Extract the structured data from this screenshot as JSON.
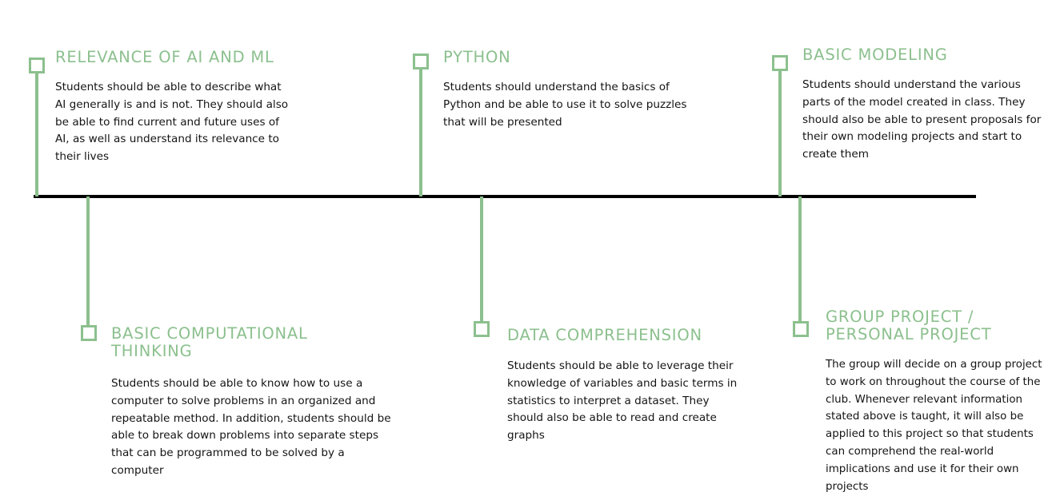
{
  "colors": {
    "accent": "#8cc08e",
    "axis": "#000000",
    "text": "#141414"
  },
  "milestones": {
    "relevance": {
      "title": "RELEVANCE OF AI AND ML",
      "description": "Students should be able to describe what AI generally is and is not. They should also be able to find current and future uses of AI, as well as understand its relevance to their lives"
    },
    "python": {
      "title": "PYTHON",
      "description": "Students should understand the basics of Python and be able to use it to solve puzzles that will be presented"
    },
    "basic_modeling": {
      "title": "BASIC MODELING",
      "description": "Students should understand the various parts of the model created in class. They should also be able to present proposals for their own modeling projects and start to create them"
    },
    "computational_thinking": {
      "title": "BASIC COMPUTATIONAL THINKING",
      "description": "Students should be able to know how to use a computer to solve problems in an organized and repeatable method. In addition, students should be able to break down problems into separate steps that can be programmed to be solved by a computer"
    },
    "data_comprehension": {
      "title": "DATA COMPREHENSION",
      "description": "Students should be able to leverage their knowledge of variables and basic terms in statistics to interpret a dataset. They should also be able to read and create graphs"
    },
    "group_project": {
      "title": "GROUP PROJECT / PERSONAL PROJECT",
      "description": "The group will decide on a group project to work on throughout the course of the club. Whenever relevant information stated above is taught, it will also be applied to this project so that students can comprehend the real-world implications and use it for their own projects"
    }
  }
}
